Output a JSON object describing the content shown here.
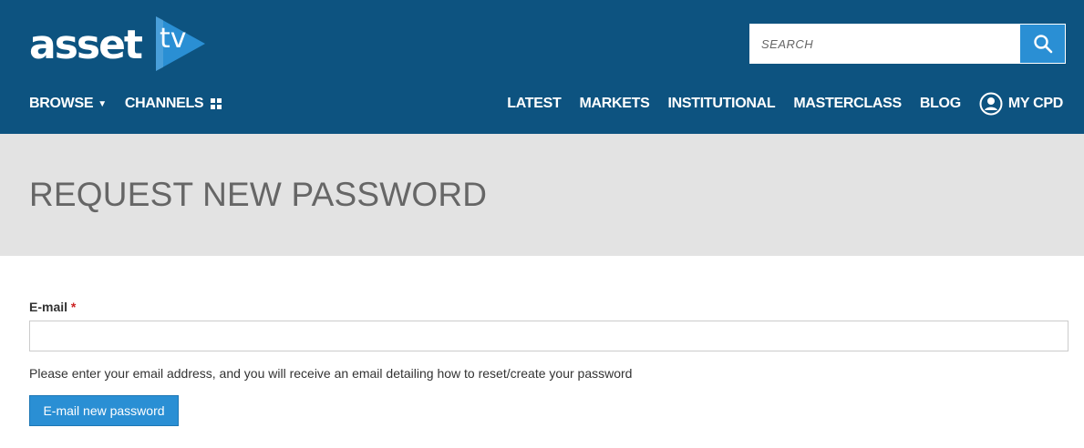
{
  "header": {
    "logo": {
      "word": "asset",
      "tv": "tv"
    },
    "search": {
      "placeholder": "SEARCH",
      "icon": "search-icon"
    },
    "nav_left": [
      {
        "label": "BROWSE",
        "icon": "caret-down-icon"
      },
      {
        "label": "CHANNELS",
        "icon": "grid-icon"
      }
    ],
    "nav_right": [
      {
        "label": "LATEST"
      },
      {
        "label": "MARKETS"
      },
      {
        "label": "INSTITUTIONAL"
      },
      {
        "label": "MASTERCLASS"
      },
      {
        "label": "BLOG"
      },
      {
        "label": "MY CPD",
        "icon": "user-icon"
      }
    ]
  },
  "page": {
    "title": "REQUEST NEW PASSWORD"
  },
  "form": {
    "email_label": "E-mail",
    "required_marker": "*",
    "email_value": "",
    "help_text": "Please enter your email address, and you will receive an email detailing how to reset/create your password",
    "submit_label": "E-mail new password"
  },
  "colors": {
    "header_bg": "#0d5380",
    "accent": "#2a8fd4",
    "title_band_bg": "#e3e3e3",
    "required": "#cc2222"
  }
}
